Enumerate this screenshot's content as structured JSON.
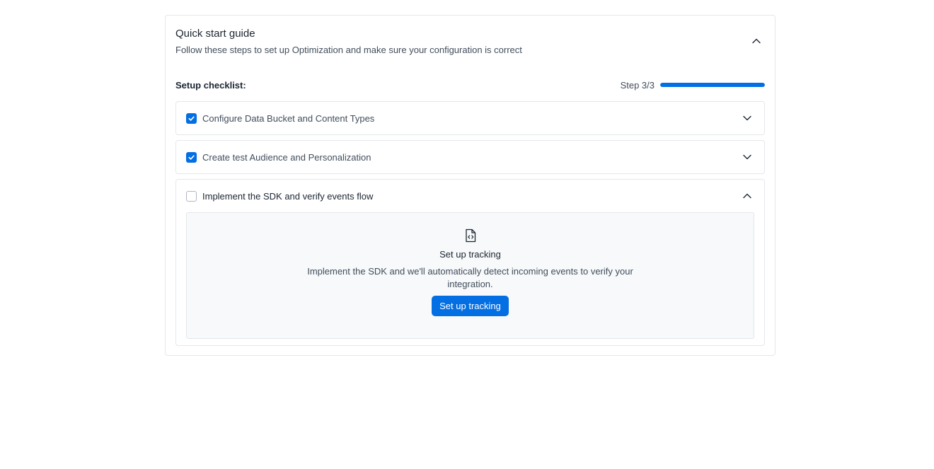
{
  "guide": {
    "title": "Quick start guide",
    "subtitle": "Follow these steps to set up Optimization and make sure your configuration is correct",
    "collapse_icon": "chevron-up-icon"
  },
  "checklist": {
    "label": "Setup checklist:",
    "step_text": "Step 3/3",
    "progress_percent": 100
  },
  "steps": [
    {
      "label": "Configure Data Bucket and Content Types",
      "checked": true,
      "expanded": false
    },
    {
      "label": "Create test Audience and Personalization",
      "checked": true,
      "expanded": false
    },
    {
      "label": "Implement the SDK and verify events flow",
      "checked": false,
      "expanded": true,
      "body": {
        "icon": "file-code-icon",
        "title": "Set up tracking",
        "description": "Implement the SDK and we'll automatically detect incoming events to verify your integration.",
        "button_label": "Set up tracking"
      }
    }
  ],
  "colors": {
    "accent": "#036fe3",
    "border": "#e3e7ec",
    "body_bg": "#f7f9fa"
  }
}
